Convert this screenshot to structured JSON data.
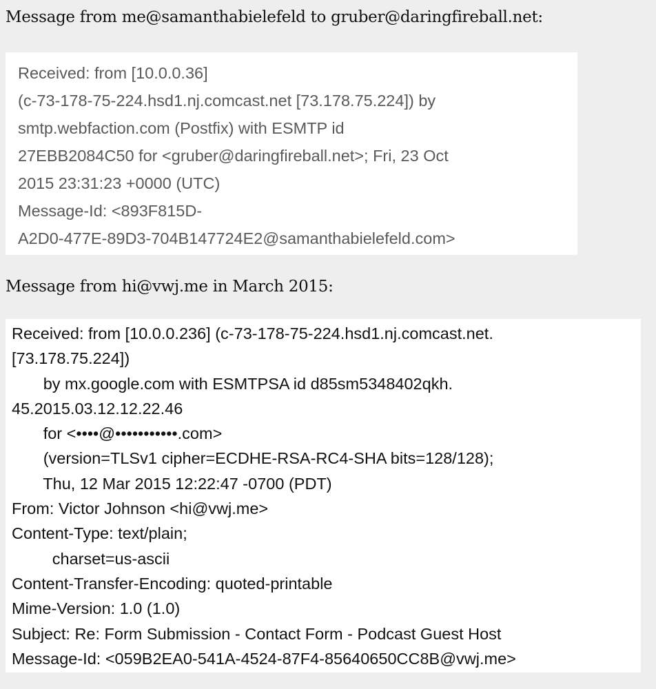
{
  "message1": {
    "heading": "Message from me@samanthabielefeld to gruber@daringfireball.net:",
    "lines": [
      "Received: from [10.0.0.36]",
      "(c-73-178-75-224.hsd1.nj.comcast.net [73.178.75.224]) by",
      "smtp.webfaction.com (Postfix) with ESMTP id",
      "27EBB2084C50 for <gruber@daringfireball.net>; Fri, 23 Oct",
      "2015 23:31:23 +0000 (UTC)",
      "Message-Id: <893F815D-",
      "A2D0-477E-89D3-704B147724E2@samanthabielefeld.com>"
    ]
  },
  "message2": {
    "heading": "Message from hi@vwj.me in March 2015:",
    "lines": [
      "Received: from [10.0.0.236] (c-73-178-75-224.hsd1.nj.comcast.net.",
      "[73.178.75.224])",
      "       by mx.google.com with ESMTPSA id d85sm5348402qkh.",
      "45.2015.03.12.12.22.46",
      "       for <••••@•••••••••••.com>",
      "       (version=TLSv1 cipher=ECDHE-RSA-RC4-SHA bits=128/128);",
      "       Thu, 12 Mar 2015 12:22:47 -0700 (PDT)",
      "From: Victor Johnson <hi@vwj.me>",
      "Content-Type: text/plain;",
      "         charset=us-ascii",
      "Content-Transfer-Encoding: quoted-printable",
      "Mime-Version: 1.0 (1.0)",
      "Subject: Re: Form Submission - Contact Form - Podcast Guest Host",
      "Message-Id: <059B2EA0-541A-4524-87F4-85640650CC8B@vwj.me>"
    ]
  }
}
